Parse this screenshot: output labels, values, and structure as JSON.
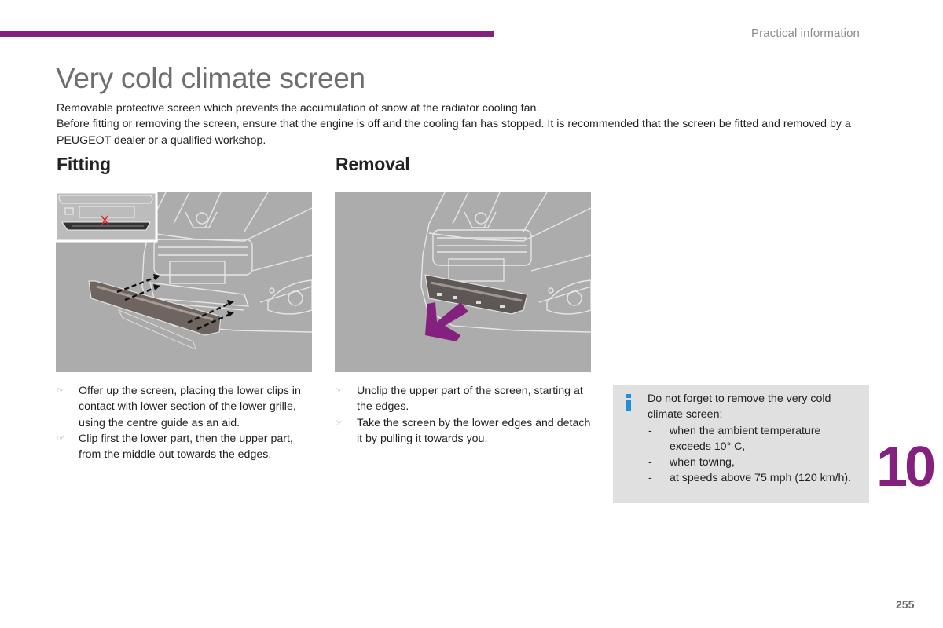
{
  "header": {
    "section_label": "Practical information",
    "accent_color": "#84217f"
  },
  "page": {
    "title": "Very cold climate screen",
    "intro": [
      "Removable protective screen which prevents the accumulation of snow at the radiator cooling fan.",
      "Before fitting or removing the screen, ensure that the engine is off and the cooling fan has stopped. It is recommended that the screen be fitted and removed by a PEUGEOT dealer or a qualified workshop."
    ],
    "chapter_number": "10",
    "page_number": "255"
  },
  "fitting": {
    "heading": "Fitting",
    "figure_alt": "Illustration: fitting the screen onto the lower grille with arrows, inset showing centre guide",
    "steps": [
      "Offer up the screen, placing the lower clips in contact with lower section of the lower grille, using the centre guide as an aid.",
      "Clip first the lower part, then the upper part, from the middle out towards the edges."
    ]
  },
  "removal": {
    "heading": "Removal",
    "figure_alt": "Illustration: removing the screen from the lower grille with a purple arrow",
    "steps": [
      "Unclip the upper part of the screen, starting at the edges.",
      "Take the screen by the lower edges and detach it by pulling it towards you."
    ]
  },
  "info": {
    "icon": "info-icon",
    "icon_color": "#1f8fd8",
    "text": "Do not forget to remove the very cold climate screen:",
    "items": [
      "when the ambient temperature exceeds 10° C,",
      "when towing,",
      "at speeds above 75 mph (120 km/h)."
    ],
    "bullet": "-"
  },
  "icons": {
    "step_bullet": "☞"
  }
}
